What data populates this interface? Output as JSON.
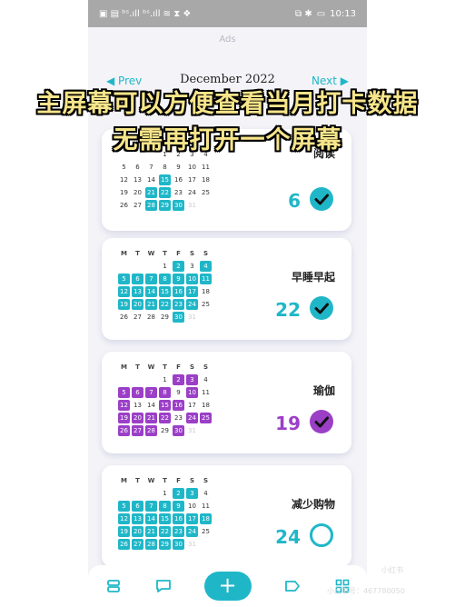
{
  "status": {
    "left_icons": "▣ ▤ ᵇˢ.ıll ᵇˢ.ıll ≋ ⧗ ❖",
    "right_icons": "⧉ ✱",
    "battery": "▭",
    "time": "10:13"
  },
  "ads": "Ads",
  "nav": {
    "prev": "Prev",
    "month": "December 2022",
    "next": "Next"
  },
  "overlay": {
    "line1": "主屏幕可以方便查看当月打卡数据",
    "line2": "无需再打开一个屏幕"
  },
  "weekdays": [
    "M",
    "T",
    "W",
    "T",
    "F",
    "S",
    "S"
  ],
  "colors": {
    "teal": "#1fb7c8",
    "purple": "#9b3fc7",
    "dim_day": "#cccccc"
  },
  "cards": [
    {
      "name": "阅读",
      "count": "6",
      "color": "#1fb7c8",
      "checked": true,
      "weeks": [
        [
          "",
          "",
          "",
          "1",
          "2",
          "3",
          "4"
        ],
        [
          "5",
          "6",
          "7",
          "8",
          "9",
          "10",
          "11"
        ],
        [
          "12",
          "13",
          "14",
          "15",
          "16",
          "17",
          "18"
        ],
        [
          "19",
          "20",
          "21",
          "22",
          "23",
          "24",
          "25"
        ],
        [
          "26",
          "27",
          "28",
          "29",
          "30",
          "31",
          ""
        ]
      ],
      "marked": [
        "15",
        "21",
        "22",
        "28",
        "29",
        "30"
      ],
      "dim": [
        "31"
      ],
      "show_header": false
    },
    {
      "name": "早睡早起",
      "count": "22",
      "color": "#1fb7c8",
      "checked": true,
      "weeks": [
        [
          "",
          "",
          "",
          "1",
          "2",
          "3",
          "4"
        ],
        [
          "5",
          "6",
          "7",
          "8",
          "9",
          "10",
          "11"
        ],
        [
          "12",
          "13",
          "14",
          "15",
          "16",
          "17",
          "18"
        ],
        [
          "19",
          "20",
          "21",
          "22",
          "23",
          "24",
          "25"
        ],
        [
          "26",
          "27",
          "28",
          "29",
          "30",
          "31",
          ""
        ]
      ],
      "marked": [
        "2",
        "4",
        "5",
        "6",
        "7",
        "8",
        "9",
        "10",
        "11",
        "12",
        "13",
        "14",
        "15",
        "16",
        "17",
        "19",
        "20",
        "21",
        "22",
        "23",
        "24",
        "30"
      ],
      "dim": [
        "31"
      ],
      "show_header": true
    },
    {
      "name": "瑜伽",
      "count": "19",
      "color": "#9b3fc7",
      "checked": true,
      "weeks": [
        [
          "",
          "",
          "",
          "1",
          "2",
          "3",
          "4"
        ],
        [
          "5",
          "6",
          "7",
          "8",
          "9",
          "10",
          "11"
        ],
        [
          "12",
          "13",
          "14",
          "15",
          "16",
          "17",
          "18"
        ],
        [
          "19",
          "20",
          "21",
          "22",
          "23",
          "24",
          "25"
        ],
        [
          "26",
          "27",
          "28",
          "29",
          "30",
          "31",
          ""
        ]
      ],
      "marked": [
        "2",
        "3",
        "5",
        "6",
        "7",
        "8",
        "10",
        "12",
        "15",
        "16",
        "19",
        "20",
        "21",
        "22",
        "24",
        "25",
        "26",
        "27",
        "28",
        "30"
      ],
      "dim": [
        "31"
      ],
      "show_header": true
    },
    {
      "name": "减少购物",
      "count": "24",
      "color": "#1fb7c8",
      "checked": false,
      "weeks": [
        [
          "",
          "",
          "",
          "1",
          "2",
          "3",
          "4"
        ],
        [
          "5",
          "6",
          "7",
          "8",
          "9",
          "10",
          "11"
        ],
        [
          "12",
          "13",
          "14",
          "15",
          "16",
          "17",
          "18"
        ],
        [
          "19",
          "20",
          "21",
          "22",
          "23",
          "24",
          "25"
        ],
        [
          "26",
          "27",
          "28",
          "29",
          "30",
          "31",
          ""
        ]
      ],
      "marked": [
        "2",
        "3",
        "5",
        "6",
        "7",
        "8",
        "9",
        "12",
        "13",
        "14",
        "15",
        "16",
        "17",
        "18",
        "19",
        "20",
        "21",
        "22",
        "23",
        "24",
        "26",
        "27",
        "28",
        "29",
        "30"
      ],
      "dim": [
        "31"
      ],
      "show_header": true
    }
  ],
  "bottom_nav": {
    "add": "+"
  },
  "watermark": {
    "logo": "小红书",
    "user": "小红书号：467780050"
  }
}
